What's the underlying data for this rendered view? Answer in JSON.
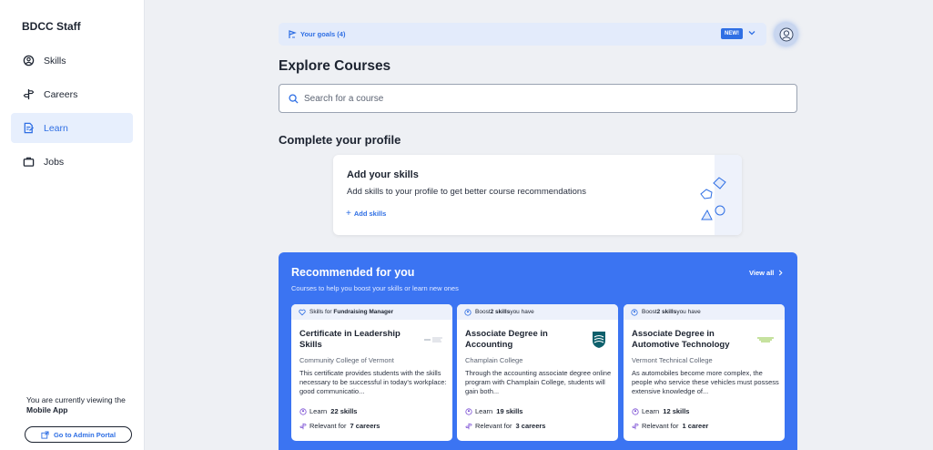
{
  "sidebar": {
    "brand": "BDCC Staff",
    "items": [
      {
        "label": "Skills",
        "icon": "skills-icon",
        "active": false
      },
      {
        "label": "Careers",
        "icon": "signpost-icon",
        "active": false
      },
      {
        "label": "Learn",
        "icon": "document-icon",
        "active": true
      },
      {
        "label": "Jobs",
        "icon": "briefcase-icon",
        "active": false
      }
    ],
    "viewing_text": "You are currently viewing the",
    "viewing_app": "Mobile App",
    "admin_button": "Go to Admin Portal"
  },
  "header": {
    "goals_label": "Your goals (4)",
    "new_badge": "NEW!"
  },
  "main": {
    "title": "Explore Courses",
    "search_placeholder": "Search for a course",
    "profile_section_title": "Complete your profile",
    "profile_card": {
      "title": "Add your skills",
      "text": "Add skills to your profile to get better course recommendations",
      "link": "Add skills"
    }
  },
  "recommended": {
    "title": "Recommended for you",
    "subtitle": "Courses to help you boost your skills or learn new ones",
    "view_all": "View all",
    "courses": [
      {
        "tag_prefix": "Skills for ",
        "tag_bold": "Fundraising Manager",
        "tag_suffix": "",
        "title": "Certificate in Leadership Skills",
        "school": "Community College of Vermont",
        "description": "This certificate provides students with the skills necessary to be successful in today's workplace: good communicatio...",
        "learn_prefix": "Learn",
        "learn_bold": "22 skills",
        "relevant_prefix": "Relevant for",
        "relevant_bold": "7 careers",
        "logo": "ccv-logo"
      },
      {
        "tag_prefix": "Boost ",
        "tag_bold": "2 skills",
        "tag_suffix": " you have",
        "title": "Associate Degree in Accounting",
        "school": "Champlain College",
        "description": "Through the accounting associate degree online program with Champlain College, students will gain both...",
        "learn_prefix": "Learn",
        "learn_bold": "19 skills",
        "relevant_prefix": "Relevant for",
        "relevant_bold": "3 careers",
        "logo": "champlain-shield-logo"
      },
      {
        "tag_prefix": "Boost ",
        "tag_bold": "2 skills",
        "tag_suffix": " you have",
        "title": "Associate Degree in Automotive Technology",
        "school": "Vermont Technical College",
        "description": "As automobiles become more complex, the people who service these vehicles must possess extensive knowledge of...",
        "learn_prefix": "Learn",
        "learn_bold": "12 skills",
        "relevant_prefix": "Relevant for",
        "relevant_bold": "1 career",
        "logo": "vtc-logo"
      }
    ]
  },
  "colors": {
    "accent": "#2f6fe4",
    "panel": "#3b74f2",
    "active_bg": "#e7effd",
    "page_bg": "#eef0f4"
  }
}
